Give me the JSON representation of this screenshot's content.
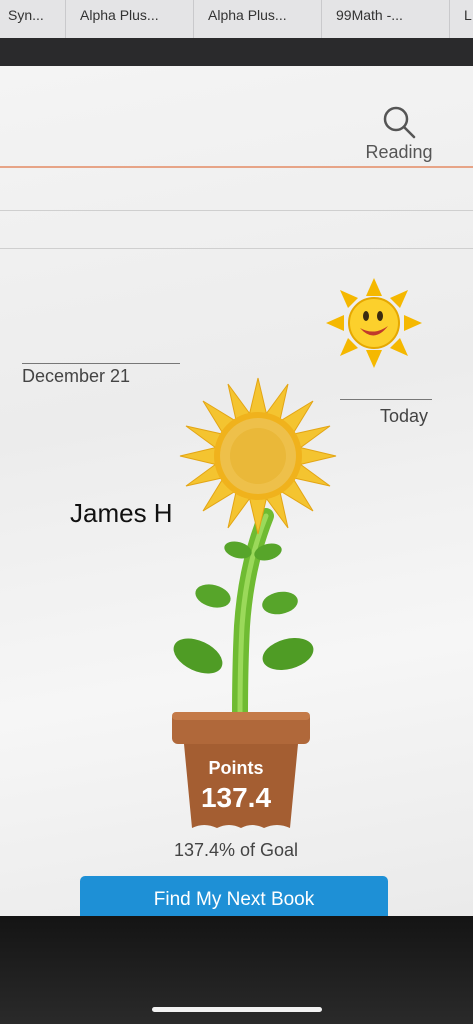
{
  "browser": {
    "tabs": [
      {
        "label": "Syn..."
      },
      {
        "label": "Alpha Plus..."
      },
      {
        "label": "Alpha Plus..."
      },
      {
        "label": "99Math -..."
      },
      {
        "label": "L"
      }
    ]
  },
  "header": {
    "search_label": "Reading"
  },
  "progress": {
    "start_label": "December 21",
    "end_label": "Today",
    "student_name": "James H",
    "points_title": "Points",
    "points_value": "137.4",
    "goal_text": "137.4% of Goal"
  },
  "actions": {
    "find_book_label": "Find My Next Book"
  },
  "colors": {
    "button": "#1e90d6",
    "pot": "#b0683a",
    "petal": "#f4c430",
    "stem": "#7cc43c",
    "sun": "#f5b800"
  },
  "icons": [
    "search-icon",
    "sun-icon",
    "sunflower-icon",
    "flower-pot-icon"
  ]
}
